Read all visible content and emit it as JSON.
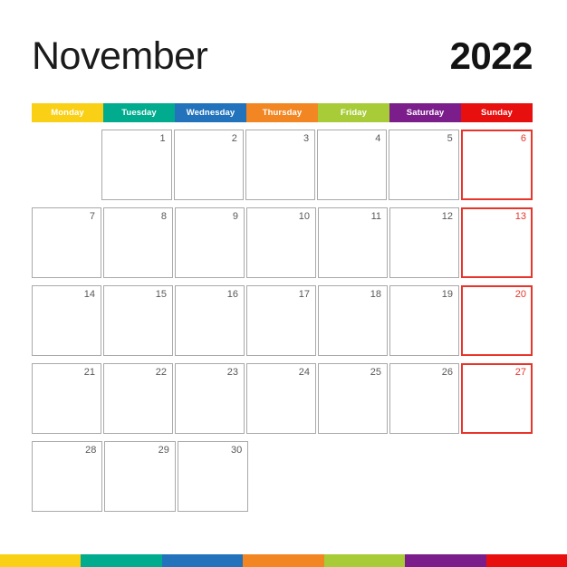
{
  "header": {
    "month": "November",
    "year": "2022"
  },
  "weekdays": [
    {
      "label": "Monday",
      "color": "#f9d015"
    },
    {
      "label": "Tuesday",
      "color": "#00ab8e"
    },
    {
      "label": "Wednesday",
      "color": "#2273bb"
    },
    {
      "label": "Thursday",
      "color": "#f28622"
    },
    {
      "label": "Friday",
      "color": "#a7cc38"
    },
    {
      "label": "Saturday",
      "color": "#7b1e8c"
    },
    {
      "label": "Sunday",
      "color": "#e8100f"
    }
  ],
  "footer_colors": [
    "#f9d015",
    "#00ab8e",
    "#2273bb",
    "#f28622",
    "#a7cc38",
    "#7b1e8c",
    "#e8100f"
  ],
  "accents": {
    "sunday_red": "#e8352b",
    "cell_border": "#a9a9a9",
    "date_text": "#58585a"
  },
  "weeks": [
    [
      {
        "date": "",
        "empty": true,
        "sunday": false
      },
      {
        "date": "1",
        "empty": false,
        "sunday": false
      },
      {
        "date": "2",
        "empty": false,
        "sunday": false
      },
      {
        "date": "3",
        "empty": false,
        "sunday": false
      },
      {
        "date": "4",
        "empty": false,
        "sunday": false
      },
      {
        "date": "5",
        "empty": false,
        "sunday": false
      },
      {
        "date": "6",
        "empty": false,
        "sunday": true
      }
    ],
    [
      {
        "date": "7",
        "empty": false,
        "sunday": false
      },
      {
        "date": "8",
        "empty": false,
        "sunday": false
      },
      {
        "date": "9",
        "empty": false,
        "sunday": false
      },
      {
        "date": "10",
        "empty": false,
        "sunday": false
      },
      {
        "date": "11",
        "empty": false,
        "sunday": false
      },
      {
        "date": "12",
        "empty": false,
        "sunday": false
      },
      {
        "date": "13",
        "empty": false,
        "sunday": true
      }
    ],
    [
      {
        "date": "14",
        "empty": false,
        "sunday": false
      },
      {
        "date": "15",
        "empty": false,
        "sunday": false
      },
      {
        "date": "16",
        "empty": false,
        "sunday": false
      },
      {
        "date": "17",
        "empty": false,
        "sunday": false
      },
      {
        "date": "18",
        "empty": false,
        "sunday": false
      },
      {
        "date": "19",
        "empty": false,
        "sunday": false
      },
      {
        "date": "20",
        "empty": false,
        "sunday": true
      }
    ],
    [
      {
        "date": "21",
        "empty": false,
        "sunday": false
      },
      {
        "date": "22",
        "empty": false,
        "sunday": false
      },
      {
        "date": "23",
        "empty": false,
        "sunday": false
      },
      {
        "date": "24",
        "empty": false,
        "sunday": false
      },
      {
        "date": "25",
        "empty": false,
        "sunday": false
      },
      {
        "date": "26",
        "empty": false,
        "sunday": false
      },
      {
        "date": "27",
        "empty": false,
        "sunday": true
      }
    ],
    [
      {
        "date": "28",
        "empty": false,
        "sunday": false
      },
      {
        "date": "29",
        "empty": false,
        "sunday": false
      },
      {
        "date": "30",
        "empty": false,
        "sunday": false
      },
      {
        "date": "",
        "empty": true,
        "sunday": false
      },
      {
        "date": "",
        "empty": true,
        "sunday": false
      },
      {
        "date": "",
        "empty": true,
        "sunday": false
      },
      {
        "date": "",
        "empty": true,
        "sunday": true
      }
    ]
  ]
}
